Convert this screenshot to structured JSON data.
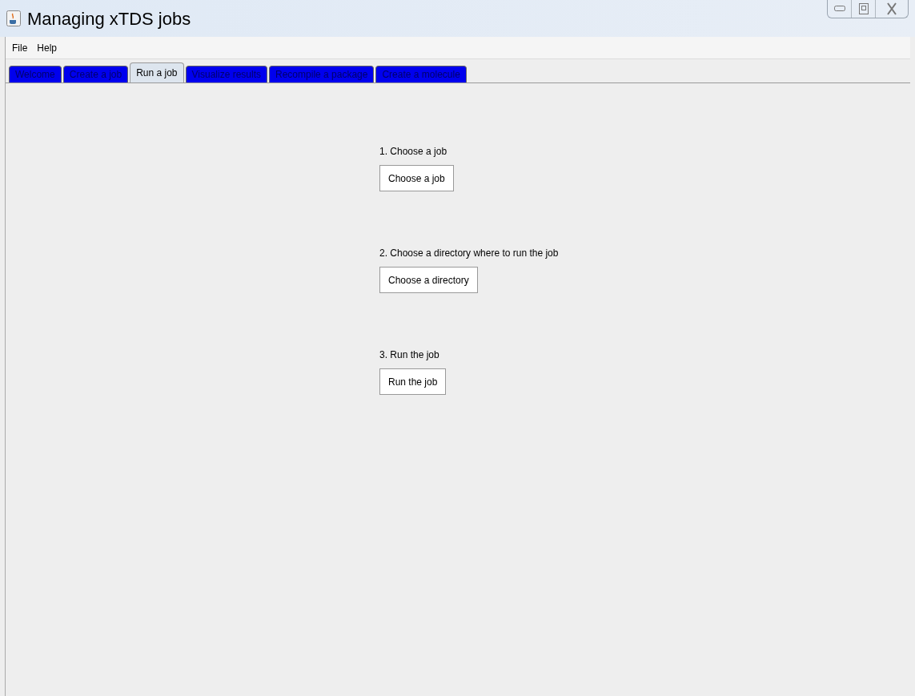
{
  "window": {
    "title": "Managing  xTDS jobs"
  },
  "menu": [
    "File",
    "Help"
  ],
  "tabs": [
    {
      "label": "Welcome",
      "selected": false
    },
    {
      "label": "Create a job",
      "selected": false
    },
    {
      "label": "Run a job",
      "selected": true
    },
    {
      "label": "Visualize results",
      "selected": false
    },
    {
      "label": "Recompile a package",
      "selected": false
    },
    {
      "label": "Create a molecule",
      "selected": false
    }
  ],
  "steps": [
    {
      "label": "1. Choose a job",
      "button": "Choose a job"
    },
    {
      "label": "2. Choose a directory where to run the job",
      "button": "Choose a directory"
    },
    {
      "label": "3. Run the job",
      "button": "Run the job"
    }
  ]
}
